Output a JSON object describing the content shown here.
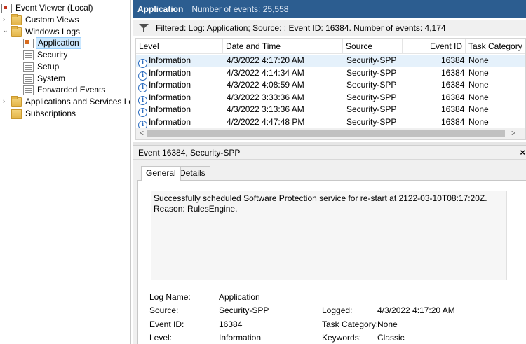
{
  "tree": {
    "items": [
      {
        "label": "Event Viewer (Local)",
        "icon": "event-viewer-icon"
      },
      {
        "label": "Custom Views",
        "icon": "folder-icon",
        "expander": "›"
      },
      {
        "label": "Windows Logs",
        "icon": "folder-icon",
        "expander": "⌄"
      },
      {
        "label": "Application",
        "icon": "log-icon"
      },
      {
        "label": "Security",
        "icon": "log-icon"
      },
      {
        "label": "Setup",
        "icon": "log-icon"
      },
      {
        "label": "System",
        "icon": "log-icon"
      },
      {
        "label": "Forwarded Events",
        "icon": "log-icon"
      },
      {
        "label": "Applications and Services Logs",
        "icon": "folder-icon",
        "expander": "›"
      },
      {
        "label": "Subscriptions",
        "icon": "subscriptions-icon"
      }
    ]
  },
  "header": {
    "title": "Application",
    "count": "Number of events: 25,558"
  },
  "filter": {
    "icon": "filter-icon",
    "text": "Filtered: Log: Application; Source: ; Event ID: 16384. Number of events: 4,174"
  },
  "grid": {
    "columns": [
      "Level",
      "Date and Time",
      "Source",
      "Event ID",
      "Task Category"
    ],
    "rows": [
      {
        "level": "Information",
        "date": "4/3/2022 4:17:20 AM",
        "source": "Security-SPP",
        "event_id": "16384",
        "task": "None"
      },
      {
        "level": "Information",
        "date": "4/3/2022 4:14:34 AM",
        "source": "Security-SPP",
        "event_id": "16384",
        "task": "None"
      },
      {
        "level": "Information",
        "date": "4/3/2022 4:08:59 AM",
        "source": "Security-SPP",
        "event_id": "16384",
        "task": "None"
      },
      {
        "level": "Information",
        "date": "4/3/2022 3:33:36 AM",
        "source": "Security-SPP",
        "event_id": "16384",
        "task": "None"
      },
      {
        "level": "Information",
        "date": "4/3/2022 3:13:36 AM",
        "source": "Security-SPP",
        "event_id": "16384",
        "task": "None"
      },
      {
        "level": "Information",
        "date": "4/2/2022 4:47:48 PM",
        "source": "Security-SPP",
        "event_id": "16384",
        "task": "None"
      }
    ],
    "scroll_left": "<",
    "scroll_right": ">"
  },
  "details": {
    "title": "Event 16384, Security-SPP",
    "close": "×",
    "tabs": [
      "General",
      "Details"
    ],
    "message": "Successfully scheduled Software Protection service for re-start at 2122-03-10T08:17:20Z. Reason: RulesEngine.",
    "fields": {
      "log_name_label": "Log Name:",
      "log_name": "Application",
      "source_label": "Source:",
      "source": "Security-SPP",
      "logged_label": "Logged:",
      "logged": "4/3/2022 4:17:20 AM",
      "event_id_label": "Event ID:",
      "event_id": "16384",
      "task_label": "Task Category:",
      "task": "None",
      "level_label": "Level:",
      "level": "Information",
      "keywords_label": "Keywords:",
      "keywords": "Classic"
    }
  },
  "colors": {
    "header_bg": "#2c5d90",
    "selection": "#cce8ff",
    "info_icon": "#2a6bbf"
  }
}
